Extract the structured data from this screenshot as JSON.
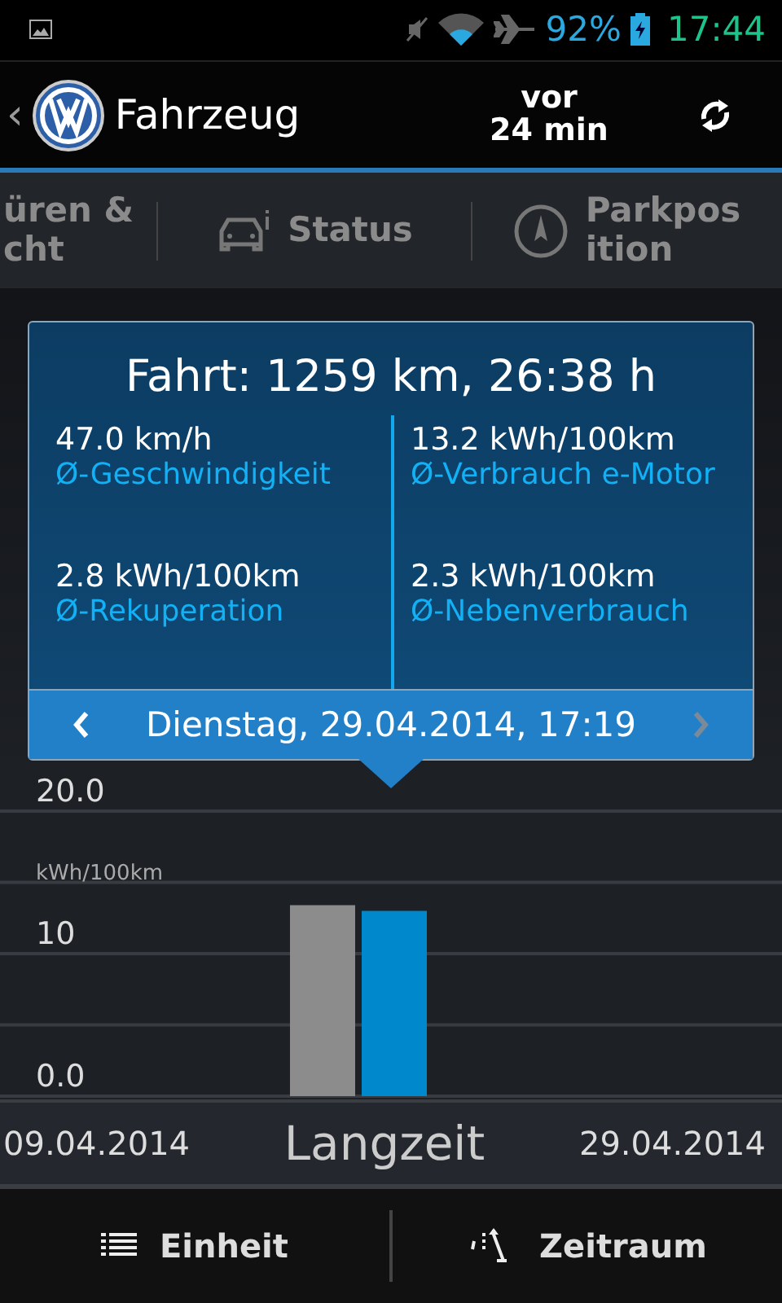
{
  "status_bar": {
    "battery": "92%",
    "time": "17:44"
  },
  "header": {
    "back": "‹",
    "title": "Fahrzeug",
    "updated": "vor\n24 min"
  },
  "tabs": [
    {
      "label": "üren &\ncht"
    },
    {
      "label": "Status"
    },
    {
      "label": "Parkpos\nition"
    }
  ],
  "popup": {
    "title": "Fahrt: 1259 km, 26:38 h",
    "stats": [
      {
        "value": "47.0 km/h",
        "label": "Ø-Geschwindigkeit"
      },
      {
        "value": "13.2 kWh/100km",
        "label": "Ø-Verbrauch e-Motor"
      },
      {
        "value": "2.8 kWh/100km",
        "label": "Ø-Rekuperation"
      },
      {
        "value": "2.3 kWh/100km",
        "label": "Ø-Nebenverbrauch"
      }
    ],
    "date": "Dienstag, 29.04.2014, 17:19",
    "prev_disabled": false,
    "next_disabled": true
  },
  "chart": {
    "chart_data": {
      "type": "bar",
      "ylabel": "kWh/100km",
      "ylim": [
        0,
        20
      ],
      "yticks": [
        {
          "value": 0,
          "label": "0.0"
        },
        10,
        {
          "value": 20,
          "label": "20.0"
        }
      ],
      "series": [
        {
          "color": "#8c8c8c",
          "values": [
            13.4
          ]
        },
        {
          "color": "#0088cc",
          "values": [
            13.0
          ]
        }
      ]
    }
  },
  "range": {
    "start": "09.04.2014",
    "label": "Langzeit",
    "end": "29.04.2014"
  },
  "bottom_bar": [
    {
      "label": "Einheit"
    },
    {
      "label": "Zeitraum"
    }
  ]
}
